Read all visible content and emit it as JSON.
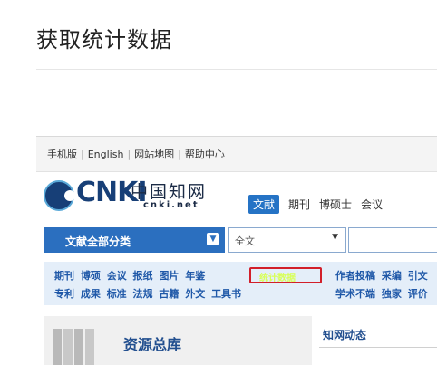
{
  "page": {
    "title": "获取统计数据"
  },
  "screenshot": {
    "top_bar": {
      "links": [
        "手机版",
        "English",
        "网站地图",
        "帮助中心"
      ]
    },
    "logo": {
      "latin": "CNKI",
      "chinese": "中国知网",
      "domain": "cnki.net"
    },
    "nav_tabs": [
      {
        "label": "文献",
        "active": true
      },
      {
        "label": "期刊",
        "active": false
      },
      {
        "label": "博硕士",
        "active": false
      },
      {
        "label": "会议",
        "active": false
      }
    ],
    "search": {
      "category_label": "文献全部分类",
      "scope_value": "全文"
    },
    "resources": {
      "row1_left": [
        "期刊",
        "博硕",
        "会议",
        "报纸",
        "图片",
        "年鉴"
      ],
      "row2_left": [
        "专利",
        "成果",
        "标准",
        "法规",
        "古籍",
        "外文",
        "工具书"
      ],
      "highlight": "统计数据",
      "row1_right": [
        "作者投稿",
        "采编",
        "引文"
      ],
      "row2_right": [
        "学术不端",
        "独家",
        "评价"
      ]
    },
    "panels": {
      "resource_title": "资源总库",
      "news_title": "知网动态"
    }
  },
  "colors": {
    "brand_blue": "#2b6fbf",
    "highlight_red": "#d21f2a",
    "highlight_text": "#d8ff58"
  }
}
